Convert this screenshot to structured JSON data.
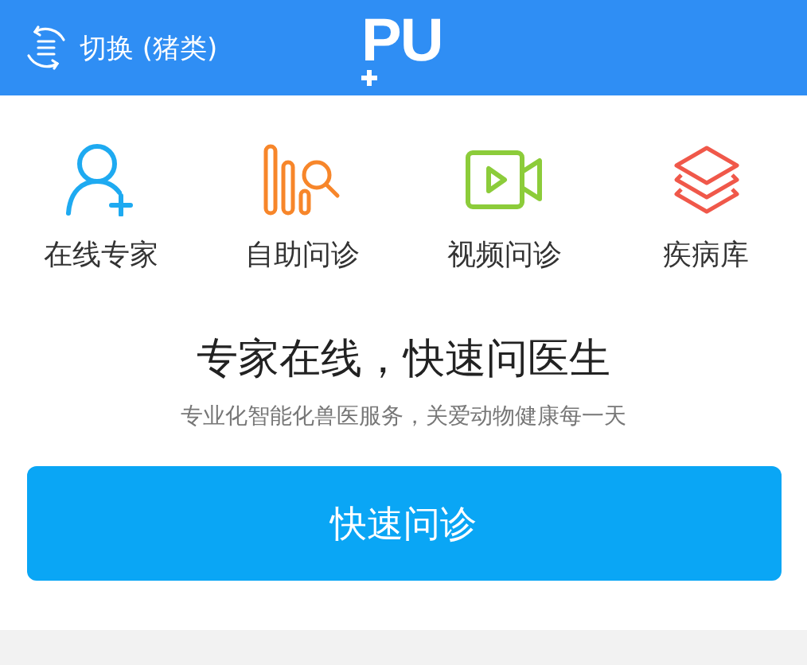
{
  "header": {
    "switch_label": "切换 (猪类)",
    "logo": "PU"
  },
  "features": [
    {
      "kind": "expert",
      "label": "在线专家"
    },
    {
      "kind": "self",
      "label": "自助问诊"
    },
    {
      "kind": "video",
      "label": "视频问诊"
    },
    {
      "kind": "library",
      "label": "疾病库"
    }
  ],
  "headline": "专家在线，快速问医生",
  "subtitle": "专业化智能化兽医服务，关爱动物健康每一天",
  "button": "快速问诊"
}
